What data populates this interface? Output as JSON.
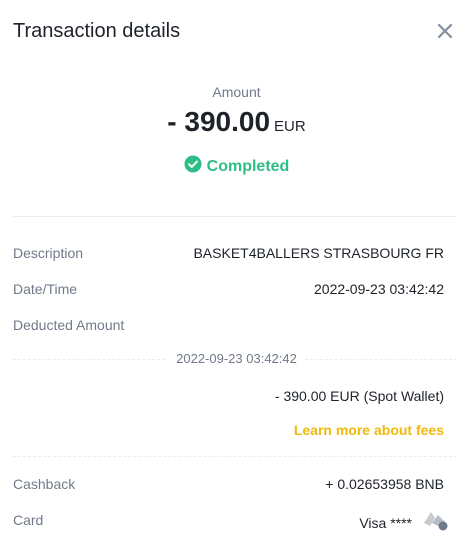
{
  "header": {
    "title": "Transaction details"
  },
  "amount": {
    "label": "Amount",
    "value": "- 390.00",
    "currency": "EUR"
  },
  "status": {
    "text": "Completed",
    "color": "#2ebd85",
    "icon": "check-circle-icon"
  },
  "details": {
    "description": {
      "label": "Description",
      "value": "BASKET4BALLERS STRASBOURG FR"
    },
    "datetime": {
      "label": "Date/Time",
      "value": "2022-09-23 03:42:42"
    },
    "deducted": {
      "label": "Deducted Amount"
    }
  },
  "deduction": {
    "date": "2022-09-23 03:42:42",
    "amount": "- 390.00 EUR (Spot Wallet)",
    "fees_link": "Learn more about fees",
    "link_color": "#f0b90b"
  },
  "cashback": {
    "label": "Cashback",
    "value": "+ 0.02653958 BNB"
  },
  "card": {
    "label": "Card",
    "value": "Visa ****",
    "icon": "card-logo-icon"
  }
}
